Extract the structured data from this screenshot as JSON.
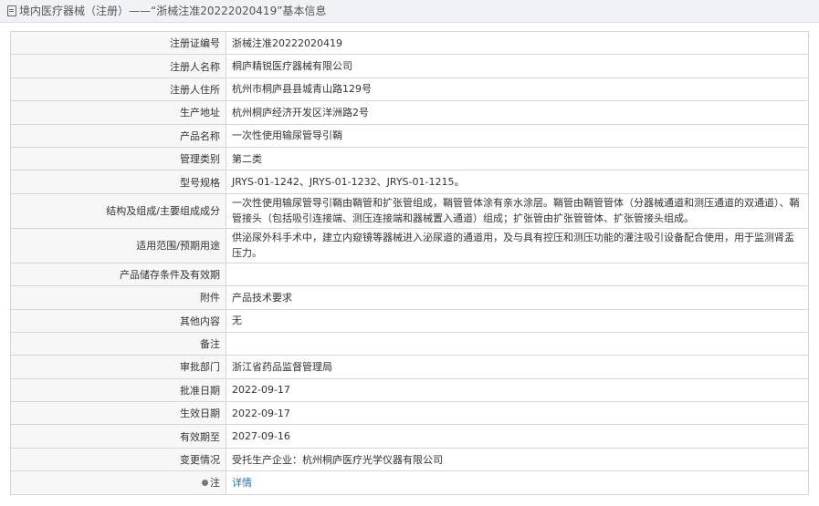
{
  "header": {
    "title": "境内医疗器械（注册）——“浙械注准20222020419”基本信息"
  },
  "rows": [
    {
      "label": "注册证编号",
      "value": "浙械注准20222020419"
    },
    {
      "label": "注册人名称",
      "value": "桐庐精锐医疗器械有限公司"
    },
    {
      "label": "注册人住所",
      "value": "杭州市桐庐县县城青山路129号"
    },
    {
      "label": "生产地址",
      "value": "杭州桐庐经济开发区洋洲路2号"
    },
    {
      "label": "产品名称",
      "value": "一次性使用输尿管导引鞘"
    },
    {
      "label": "管理类别",
      "value": "第二类"
    },
    {
      "label": "型号规格",
      "value": "JRYS-01-1242、JRYS-01-1232、JRYS-01-1215。"
    },
    {
      "label": "结构及组成/主要组成成分",
      "value": "一次性使用输尿管导引鞘由鞘管和扩张管组成，鞘管管体涂有亲水涂层。鞘管由鞘管管体（分器械通道和测压通道的双通道）、鞘管接头（包括吸引连接端、测压连接端和器械置入通道）组成；扩张管由扩张管管体、扩张管接头组成。"
    },
    {
      "label": "适用范围/预期用途",
      "value": "供泌尿外科手术中，建立内窥镜等器械进入泌尿道的通道用，及与具有控压和测压功能的灌注吸引设备配合使用，用于监测肾盂压力。"
    },
    {
      "label": "产品储存条件及有效期",
      "value": ""
    },
    {
      "label": "附件",
      "value": "产品技术要求"
    },
    {
      "label": "其他内容",
      "value": "无"
    },
    {
      "label": "备注",
      "value": ""
    },
    {
      "label": "审批部门",
      "value": "浙江省药品监督管理局"
    },
    {
      "label": "批准日期",
      "value": "2022-09-17"
    },
    {
      "label": "生效日期",
      "value": "2022-09-17"
    },
    {
      "label": "有效期至",
      "value": "2027-09-16"
    },
    {
      "label": "变更情况",
      "value": "受托生产企业：杭州桐庐医疗光学仪器有限公司"
    }
  ],
  "note": {
    "label": "注",
    "link": "详情",
    "icon": "dot-icon",
    "link_color": "#2a6ebb"
  }
}
